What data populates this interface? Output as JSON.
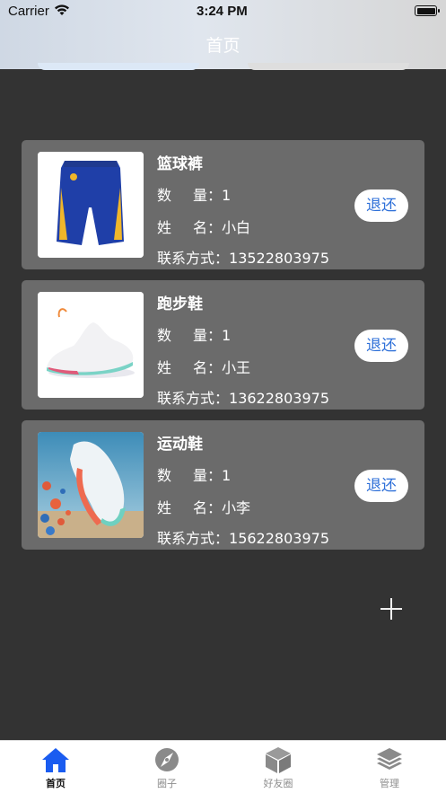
{
  "status_bar": {
    "carrier": "Carrier",
    "time": "3:24 PM"
  },
  "header": {
    "title": "首页"
  },
  "labels": {
    "quantity_chars": [
      "数",
      "量："
    ],
    "person_chars": [
      "姓",
      "名："
    ],
    "contact": "联系方式："
  },
  "items": [
    {
      "name": "篮球裤",
      "quantity": "1",
      "person": "小白",
      "phone": "13522803975",
      "action": "退还",
      "image_icon": "basketball-shorts"
    },
    {
      "name": "跑步鞋",
      "quantity": "1",
      "person": "小王",
      "phone": "13622803975",
      "action": "退还",
      "image_icon": "running-shoe"
    },
    {
      "name": "运动鞋",
      "quantity": "1",
      "person": "小李",
      "phone": "15622803975",
      "action": "退还",
      "image_icon": "sneaker"
    }
  ],
  "tabs": [
    {
      "label": "首页",
      "icon": "home-icon",
      "active": true
    },
    {
      "label": "圈子",
      "icon": "compass-icon",
      "active": false
    },
    {
      "label": "好友圈",
      "icon": "cube-icon",
      "active": false
    },
    {
      "label": "管理",
      "icon": "layers-icon",
      "active": false
    }
  ],
  "colors": {
    "accent": "#2d6fd8",
    "tab_active": "#1a5cf0",
    "card_bg": "#6b6b6b",
    "page_bg": "#333333"
  }
}
